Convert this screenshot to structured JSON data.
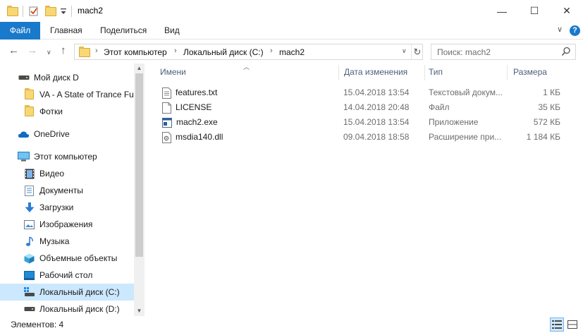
{
  "window": {
    "title": "mach2",
    "minimize_glyph": "—",
    "maximize_glyph": "☐",
    "close_glyph": "✕"
  },
  "ribbon": {
    "tabs": [
      "Файл",
      "Главная",
      "Поделиться",
      "Вид"
    ],
    "collapse_glyph": "∨",
    "help_glyph": "?"
  },
  "nav": {
    "back_glyph": "←",
    "forward_glyph": "→",
    "recent_glyph": "∨",
    "up_glyph": "↑",
    "breadcrumbs": [
      "Этот компьютер",
      "Локальный диск (C:)",
      "mach2"
    ],
    "breadcrumb_sep": "›",
    "dropdown_glyph": "∨",
    "refresh_glyph": "↻",
    "search_placeholder": "Поиск: mach2"
  },
  "sidebar": {
    "items": [
      {
        "label": "Мой диск D",
        "icon": "drive-icon"
      },
      {
        "label": "VA - A State of Trance Fut",
        "icon": "folder-icon"
      },
      {
        "label": "Фотки",
        "icon": "folder-icon"
      },
      {
        "label": "OneDrive",
        "icon": "cloud-icon"
      },
      {
        "label": "Этот компьютер",
        "icon": "computer-icon"
      },
      {
        "label": "Видео",
        "icon": "video-icon"
      },
      {
        "label": "Документы",
        "icon": "documents-icon"
      },
      {
        "label": "Загрузки",
        "icon": "download-icon"
      },
      {
        "label": "Изображения",
        "icon": "pictures-icon"
      },
      {
        "label": "Музыка",
        "icon": "music-icon"
      },
      {
        "label": "Объемные объекты",
        "icon": "3d-objects-icon"
      },
      {
        "label": "Рабочий стол",
        "icon": "desktop-icon"
      },
      {
        "label": "Локальный диск (C:)",
        "icon": "system-drive-icon",
        "selected": true
      },
      {
        "label": "Локальный диск (D:)",
        "icon": "drive-icon"
      }
    ]
  },
  "columns": {
    "name": "Имени",
    "date": "Дата изменения",
    "type": "Тип",
    "size": "Размера"
  },
  "files": [
    {
      "name": "features.txt",
      "date": "15.04.2018 13:54",
      "type": "Текстовый докум...",
      "size": "1 КБ",
      "icon": "text-file-icon"
    },
    {
      "name": "LICENSE",
      "date": "14.04.2018 20:48",
      "type": "Файл",
      "size": "35 КБ",
      "icon": "file-icon"
    },
    {
      "name": "mach2.exe",
      "date": "15.04.2018 13:54",
      "type": "Приложение",
      "size": "572 КБ",
      "icon": "exe-icon"
    },
    {
      "name": "msdia140.dll",
      "date": "09.04.2018 18:58",
      "type": "Расширение при...",
      "size": "1 184 КБ",
      "icon": "dll-icon"
    }
  ],
  "status": {
    "item_count": "Элементов: 4"
  },
  "colors": {
    "accent": "#1979ca",
    "selection": "#cce8ff",
    "folder": "#f8d775"
  }
}
